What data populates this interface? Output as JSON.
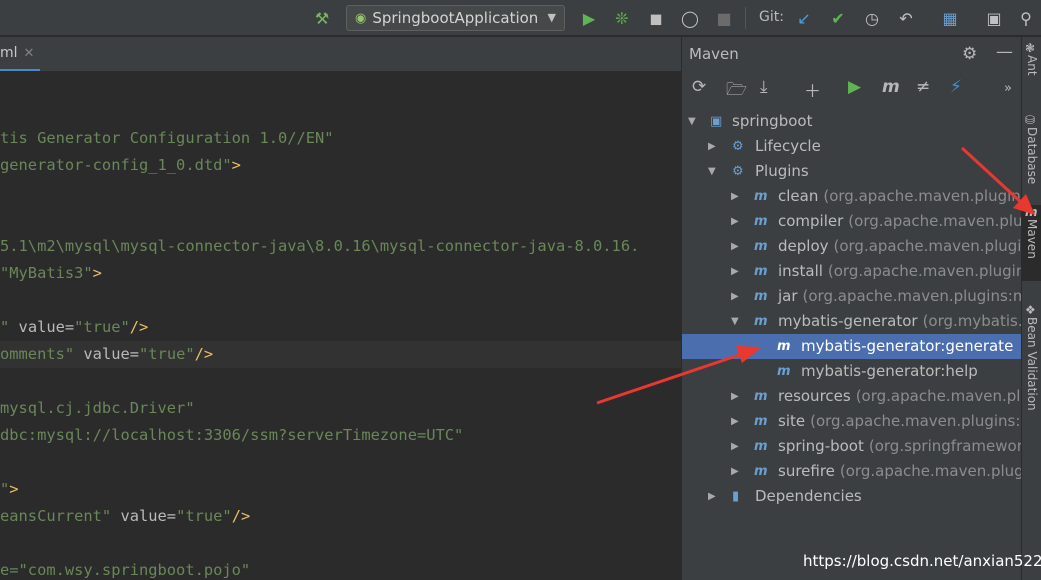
{
  "toolbar": {
    "run_config": "SpringbootApplication",
    "git_label": "Git:"
  },
  "editor": {
    "tab_label": "ml",
    "lines": [
      {
        "parts": [
          {
            "c": "s",
            "t": "tis Generator Configuration 1.0//EN\""
          }
        ]
      },
      {
        "parts": [
          {
            "c": "s",
            "t": "generator-config_1_0.dtd\""
          },
          {
            "c": "t",
            "t": ">"
          }
        ]
      },
      {
        "parts": [
          {
            "c": "s",
            "t": "5.1\\m2\\mysql\\mysql-connector-java\\8.0.16\\mysql-connector-java-8.0.16."
          }
        ]
      },
      {
        "parts": [
          {
            "c": "s",
            "t": "\"MyBatis3\""
          },
          {
            "c": "t",
            "t": ">"
          }
        ]
      },
      {
        "parts": [
          {
            "c": "s",
            "t": "\""
          },
          {
            "c": "a",
            "t": " value="
          },
          {
            "c": "s",
            "t": "\"true\""
          },
          {
            "c": "t",
            "t": "/>"
          }
        ]
      },
      {
        "parts": [
          {
            "c": "s",
            "t": "omments\""
          },
          {
            "c": "a",
            "t": " value="
          },
          {
            "c": "s",
            "t": "\"true\""
          },
          {
            "c": "t",
            "t": "/>"
          }
        ]
      },
      {
        "parts": [
          {
            "c": "s",
            "t": "mysql.cj.jdbc.Driver\""
          }
        ]
      },
      {
        "parts": [
          {
            "c": "s",
            "t": "dbc:mysql://localhost:3306/ssm?serverTimezone=UTC\""
          }
        ]
      },
      {
        "parts": [
          {
            "c": "s",
            "t": "\""
          },
          {
            "c": "t",
            "t": ">"
          }
        ]
      },
      {
        "parts": [
          {
            "c": "s",
            "t": "eansCurrent\""
          },
          {
            "c": "a",
            "t": " value="
          },
          {
            "c": "s",
            "t": "\"true\""
          },
          {
            "c": "t",
            "t": "/>"
          }
        ]
      },
      {
        "parts": [
          {
            "c": "s",
            "t": "e=\"com.wsy.springboot.pojo\""
          }
        ]
      }
    ]
  },
  "maven": {
    "title": "Maven",
    "tree": [
      {
        "label": "springboot",
        "group": ""
      },
      {
        "label": "Lifecycle",
        "group": ""
      },
      {
        "label": "Plugins",
        "group": ""
      },
      {
        "label": "clean",
        "group": "(org.apache.maven.plugins:m"
      },
      {
        "label": "compiler",
        "group": "(org.apache.maven.plugins"
      },
      {
        "label": "deploy",
        "group": "(org.apache.maven.plugins:m"
      },
      {
        "label": "install",
        "group": "(org.apache.maven.plugins:ma"
      },
      {
        "label": "jar",
        "group": "(org.apache.maven.plugins:maver"
      },
      {
        "label": "mybatis-generator",
        "group": "(org.mybatis.gene"
      },
      {
        "label": "mybatis-generator:generate",
        "group": ""
      },
      {
        "label": "mybatis-generator:help",
        "group": ""
      },
      {
        "label": "resources",
        "group": "(org.apache.maven.plugins:"
      },
      {
        "label": "site",
        "group": "(org.apache.maven.plugins:mave"
      },
      {
        "label": "spring-boot",
        "group": "(org.springframework.bo"
      },
      {
        "label": "surefire",
        "group": "(org.apache.maven.plugins:n"
      },
      {
        "label": "Dependencies",
        "group": ""
      }
    ]
  },
  "stripe": {
    "ant": "Ant",
    "database": "Database",
    "maven": "Maven",
    "bean_validation": "Bean Validation"
  },
  "watermark": "https://blog.csdn.net/anxian5227",
  "colors": {
    "selection": "#4b6eaf",
    "annotation_arrow": "#e8382f",
    "run_green": "#5fb550"
  }
}
